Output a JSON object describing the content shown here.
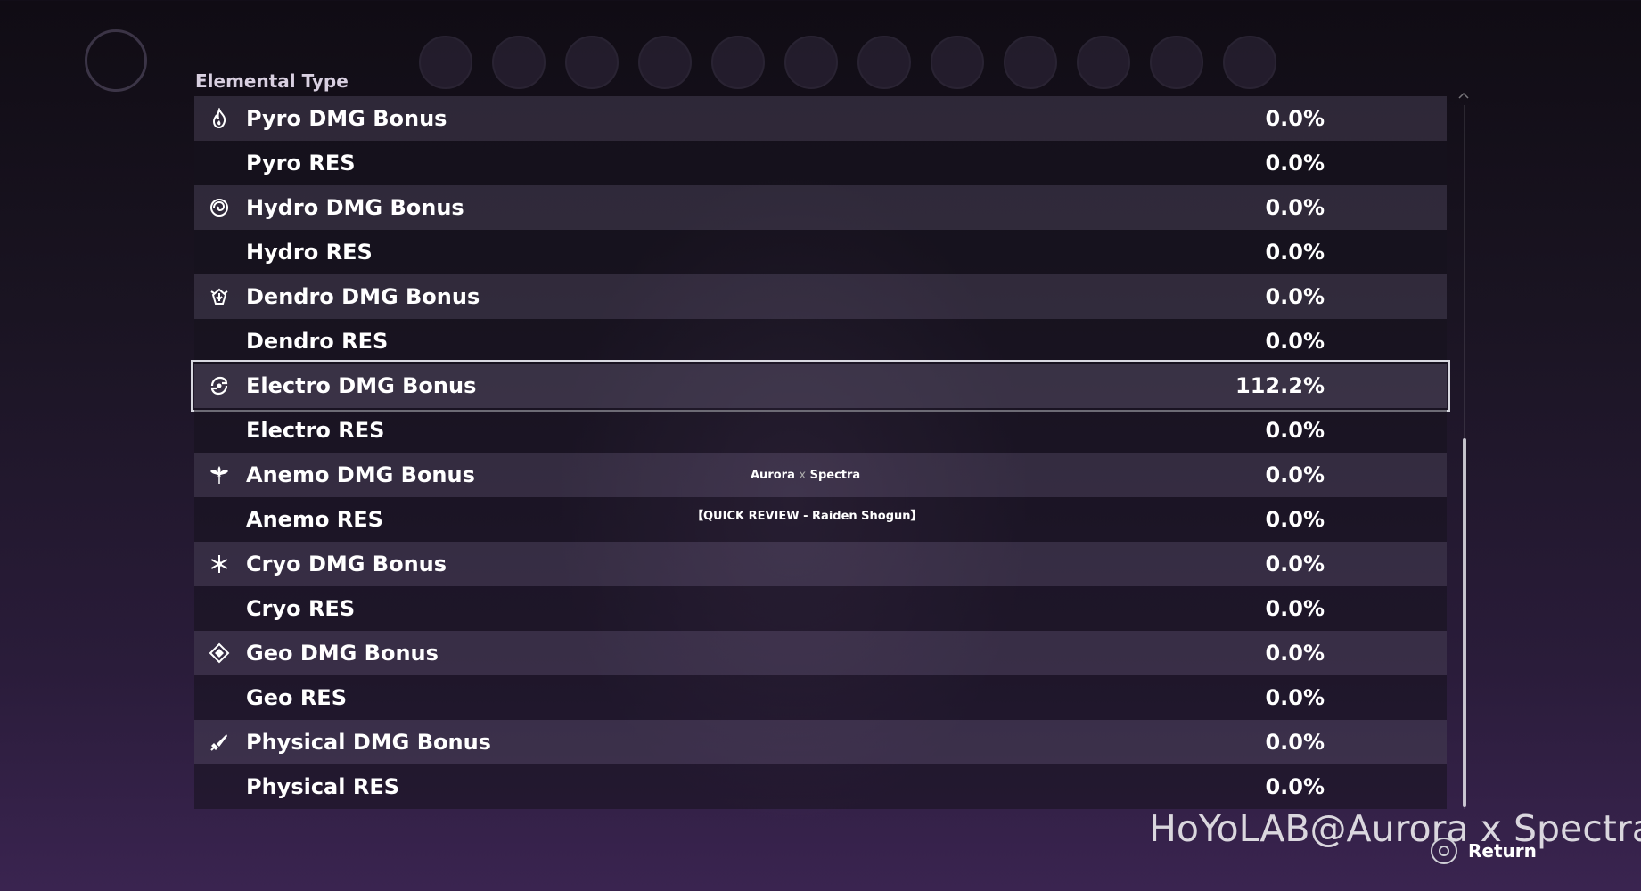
{
  "section": {
    "title": "Elemental Type"
  },
  "rows": [
    {
      "label": "Pyro DMG Bonus",
      "value": "0.0%",
      "icon": "pyro-icon"
    },
    {
      "label": "Pyro RES",
      "value": "0.0%"
    },
    {
      "label": "Hydro DMG Bonus",
      "value": "0.0%",
      "icon": "hydro-icon"
    },
    {
      "label": "Hydro RES",
      "value": "0.0%"
    },
    {
      "label": "Dendro DMG Bonus",
      "value": "0.0%",
      "icon": "dendro-icon"
    },
    {
      "label": "Dendro RES",
      "value": "0.0%"
    },
    {
      "label": "Electro DMG Bonus",
      "value": "112.2%",
      "icon": "electro-icon",
      "selected": true
    },
    {
      "label": "Electro RES",
      "value": "0.0%"
    },
    {
      "label": "Anemo DMG Bonus",
      "value": "0.0%",
      "icon": "anemo-icon"
    },
    {
      "label": "Anemo RES",
      "value": "0.0%"
    },
    {
      "label": "Cryo DMG Bonus",
      "value": "0.0%",
      "icon": "cryo-icon"
    },
    {
      "label": "Cryo RES",
      "value": "0.0%"
    },
    {
      "label": "Geo DMG Bonus",
      "value": "0.0%",
      "icon": "geo-icon"
    },
    {
      "label": "Geo RES",
      "value": "0.0%"
    },
    {
      "label": "Physical DMG Bonus",
      "value": "0.0%",
      "icon": "physical-icon"
    },
    {
      "label": "Physical RES",
      "value": "0.0%"
    }
  ],
  "overlay": {
    "credit_left": "Aurora",
    "credit_x": "x",
    "credit_right": "Spectra",
    "review": "【QUICK REVIEW - Raiden Shogun】",
    "watermark": "HoYoLAB@Aurora x Spectra"
  },
  "footer": {
    "return_label": "Return"
  },
  "colors": {
    "text": "#ffffff",
    "row_light": "#463e52",
    "row_dark": "#16121e",
    "selected_border": "#d8d8e0"
  }
}
